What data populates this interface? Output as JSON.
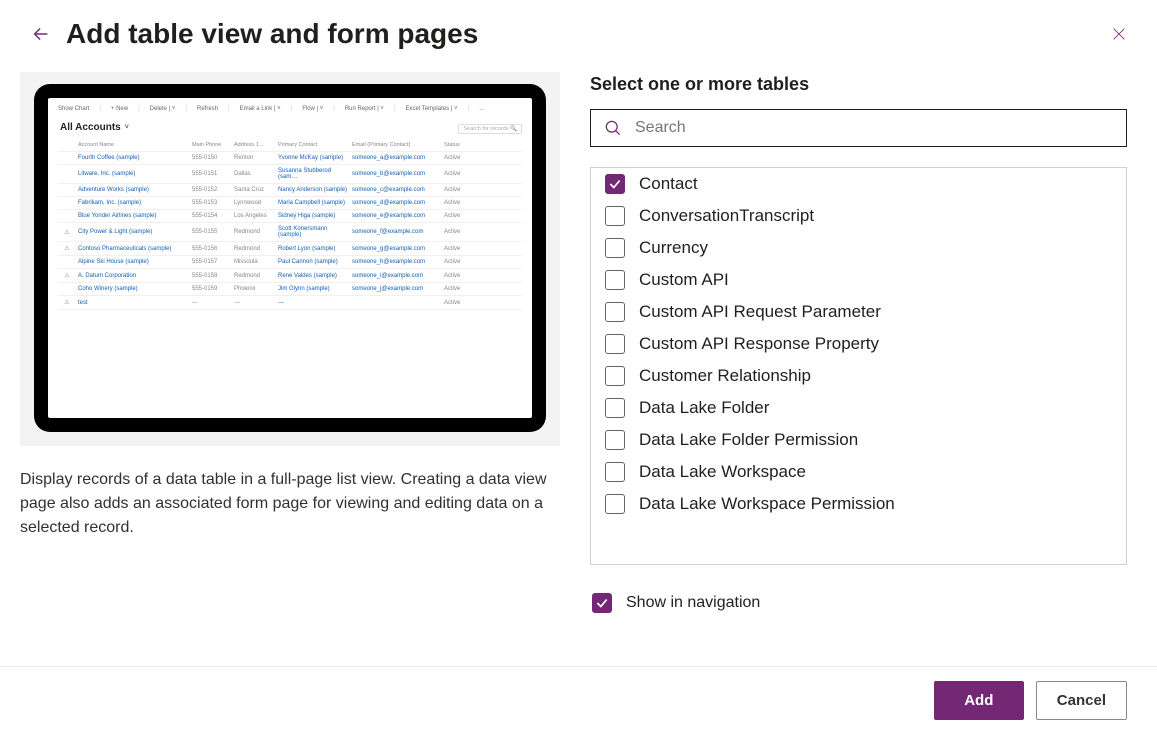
{
  "header": {
    "title": "Add table view and form pages"
  },
  "left": {
    "description": "Display records of a data table in a full-page list view. Creating a data view page also adds an associated form page for viewing and editing data on a selected record.",
    "preview": {
      "commandbar": [
        "Show Chart",
        "+ New",
        "Delete  | ˅",
        "Refresh",
        "Email a Link  | ˅",
        "Flow  | ˅",
        "Run Report  | ˅",
        "Excel Templates  | ˅",
        "…"
      ],
      "view_title": "All Accounts",
      "search_placeholder": "Search for records",
      "columns": [
        "",
        "Account Name",
        "Main Phone",
        "Address 1…",
        "Primary Contact",
        "Email (Primary Contact)",
        "Status"
      ],
      "rows": [
        {
          "icon": "",
          "name": "Fourth Coffee (sample)",
          "phone": "555-0150",
          "city": "Renton",
          "contact": "Yvonne McKay (sample)",
          "email": "someone_a@example.com",
          "status": "Active"
        },
        {
          "icon": "",
          "name": "Litware, Inc. (sample)",
          "phone": "555-0151",
          "city": "Dallas",
          "contact": "Susanna Stubberod (sam…",
          "email": "someone_b@example.com",
          "status": "Active"
        },
        {
          "icon": "",
          "name": "Adventure Works (sample)",
          "phone": "555-0152",
          "city": "Santa Cruz",
          "contact": "Nancy Anderson (sample)",
          "email": "someone_c@example.com",
          "status": "Active"
        },
        {
          "icon": "",
          "name": "Fabrikam, Inc. (sample)",
          "phone": "555-0153",
          "city": "Lynnwood",
          "contact": "Maria Campbell (sample)",
          "email": "someone_d@example.com",
          "status": "Active"
        },
        {
          "icon": "",
          "name": "Blue Yonder Airlines (sample)",
          "phone": "555-0154",
          "city": "Los Angeles",
          "contact": "Sidney Higa (sample)",
          "email": "someone_e@example.com",
          "status": "Active"
        },
        {
          "icon": "⚠",
          "name": "City Power & Light (sample)",
          "phone": "555-0155",
          "city": "Redmond",
          "contact": "Scott Konersmann (sample)",
          "email": "someone_f@example.com",
          "status": "Active"
        },
        {
          "icon": "⚠",
          "name": "Contoso Pharmaceuticals (sample)",
          "phone": "555-0156",
          "city": "Redmond",
          "contact": "Robert Lyon (sample)",
          "email": "someone_g@example.com",
          "status": "Active"
        },
        {
          "icon": "",
          "name": "Alpine Ski House (sample)",
          "phone": "555-0157",
          "city": "Missoula",
          "contact": "Paul Cannon (sample)",
          "email": "someone_h@example.com",
          "status": "Active"
        },
        {
          "icon": "⚠",
          "name": "A. Datum Corporation",
          "phone": "555-0158",
          "city": "Redmond",
          "contact": "Rene Valdes (sample)",
          "email": "someone_i@example.com",
          "status": "Active"
        },
        {
          "icon": "",
          "name": "Coho Winery (sample)",
          "phone": "555-0159",
          "city": "Phoenix",
          "contact": "Jim Glynn (sample)",
          "email": "someone_j@example.com",
          "status": "Active"
        },
        {
          "icon": "⚠",
          "name": "test",
          "phone": "---",
          "city": "---",
          "contact": "---",
          "email": "",
          "status": "Active"
        }
      ]
    }
  },
  "right": {
    "section_label": "Select one or more tables",
    "search_placeholder": "Search",
    "tables": [
      {
        "label": "Contact",
        "checked": true
      },
      {
        "label": "ConversationTranscript",
        "checked": false
      },
      {
        "label": "Currency",
        "checked": false
      },
      {
        "label": "Custom API",
        "checked": false
      },
      {
        "label": "Custom API Request Parameter",
        "checked": false
      },
      {
        "label": "Custom API Response Property",
        "checked": false
      },
      {
        "label": "Customer Relationship",
        "checked": false
      },
      {
        "label": "Data Lake Folder",
        "checked": false
      },
      {
        "label": "Data Lake Folder Permission",
        "checked": false
      },
      {
        "label": "Data Lake Workspace",
        "checked": false
      },
      {
        "label": "Data Lake Workspace Permission",
        "checked": false
      }
    ],
    "show_in_nav": {
      "label": "Show in navigation",
      "checked": true
    }
  },
  "footer": {
    "primary": "Add",
    "secondary": "Cancel"
  }
}
